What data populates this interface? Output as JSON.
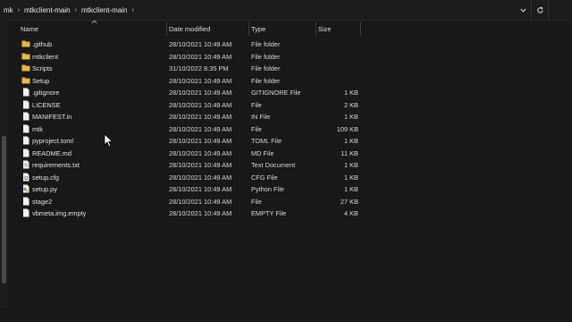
{
  "breadcrumb": {
    "items": [
      "mk",
      "mtkclient-main",
      "mtkclient-main"
    ],
    "separator": "›"
  },
  "addressbar": {
    "dropdown_icon": "chevron-down-icon",
    "refresh_icon": "refresh-icon"
  },
  "columns": {
    "name": "Name",
    "date": "Date modified",
    "type": "Type",
    "size": "Size"
  },
  "files": [
    {
      "name": ".github",
      "date": "28/10/2021 10:49 AM",
      "type": "File folder",
      "size": "",
      "icon": "folder-icon"
    },
    {
      "name": "mtkclient",
      "date": "28/10/2021 10:49 AM",
      "type": "File folder",
      "size": "",
      "icon": "folder-icon"
    },
    {
      "name": "Scripts",
      "date": "31/10/2022 8:35 PM",
      "type": "File folder",
      "size": "",
      "icon": "folder-icon"
    },
    {
      "name": "Setup",
      "date": "28/10/2021 10:49 AM",
      "type": "File folder",
      "size": "",
      "icon": "folder-icon"
    },
    {
      "name": ".gitignore",
      "date": "28/10/2021 10:49 AM",
      "type": "GITIGNORE File",
      "size": "1 KB",
      "icon": "file-icon"
    },
    {
      "name": "LICENSE",
      "date": "28/10/2021 10:49 AM",
      "type": "File",
      "size": "2 KB",
      "icon": "file-icon"
    },
    {
      "name": "MANIFEST.in",
      "date": "28/10/2021 10:49 AM",
      "type": "IN File",
      "size": "1 KB",
      "icon": "file-icon"
    },
    {
      "name": "mtk",
      "date": "28/10/2021 10:49 AM",
      "type": "File",
      "size": "109 KB",
      "icon": "file-icon"
    },
    {
      "name": "pyproject.toml",
      "date": "28/10/2021 10:49 AM",
      "type": "TOML File",
      "size": "1 KB",
      "icon": "file-icon"
    },
    {
      "name": "README.md",
      "date": "28/10/2021 10:49 AM",
      "type": "MD File",
      "size": "11 KB",
      "icon": "file-icon"
    },
    {
      "name": "requirements.txt",
      "date": "28/10/2021 10:49 AM",
      "type": "Text Document",
      "size": "1 KB",
      "icon": "text-file-icon"
    },
    {
      "name": "setup.cfg",
      "date": "28/10/2021 10:49 AM",
      "type": "CFG File",
      "size": "1 KB",
      "icon": "settings-file-icon"
    },
    {
      "name": "setup.py",
      "date": "28/10/2021 10:49 AM",
      "type": "Python File",
      "size": "1 KB",
      "icon": "python-file-icon"
    },
    {
      "name": "stage2",
      "date": "28/10/2021 10:49 AM",
      "type": "File",
      "size": "27 KB",
      "icon": "file-icon"
    },
    {
      "name": "vbmeta.img.empty",
      "date": "28/10/2021 10:49 AM",
      "type": "EMPTY File",
      "size": "4 KB",
      "icon": "file-icon"
    }
  ],
  "colors": {
    "background": "#191919",
    "folder": "#e8b64a",
    "text": "#e2e2e2"
  }
}
